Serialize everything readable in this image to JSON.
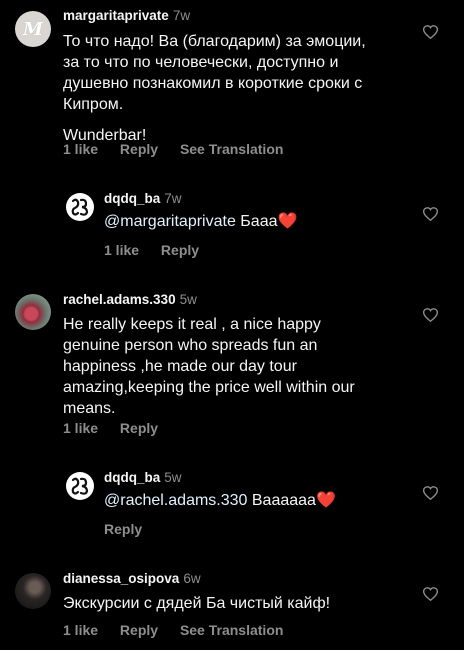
{
  "comments": [
    {
      "username": "margaritaprivate",
      "time": "7w",
      "avatar_letter": "M",
      "text_lines": [
        "То что надо! Ва (благодарим) за эмоции,",
        "за то что по человечески, доступно и",
        "душевно познакомил в короткие сроки с",
        "Кипром."
      ],
      "text_line2": "Wunderbar!",
      "likes": "1 like",
      "reply": "Reply",
      "translate": "See Translation"
    },
    {
      "username": "dqdq_ba",
      "time": "7w",
      "mention": "@margaritaprivate",
      "text": " Бааа",
      "emoji": "❤️",
      "likes": "1 like",
      "reply": "Reply"
    },
    {
      "username": "rachel.adams.330",
      "time": "5w",
      "text_lines": [
        "He really keeps it real , a nice happy",
        "genuine  person who spreads fun an",
        "happiness ,he made our day tour",
        "amazing,keeping the price well within our",
        "means."
      ],
      "likes": "1 like",
      "reply": "Reply"
    },
    {
      "username": "dqdq_ba",
      "time": "5w",
      "mention": "@rachel.adams.330",
      "text": " Ваааааа",
      "emoji": "❤️",
      "reply": "Reply"
    },
    {
      "username": "dianessa_osipova",
      "time": "6w",
      "text": "Экскурсии с дядей Ба чистый кайф!",
      "likes": "1 like",
      "reply": "Reply",
      "translate": "See Translation"
    }
  ],
  "colors": {
    "background": "#000000",
    "text": "#f5f5f5",
    "muted": "#8e8e8e",
    "mention": "#e0f1ff",
    "heart": "#ff1f3d"
  }
}
